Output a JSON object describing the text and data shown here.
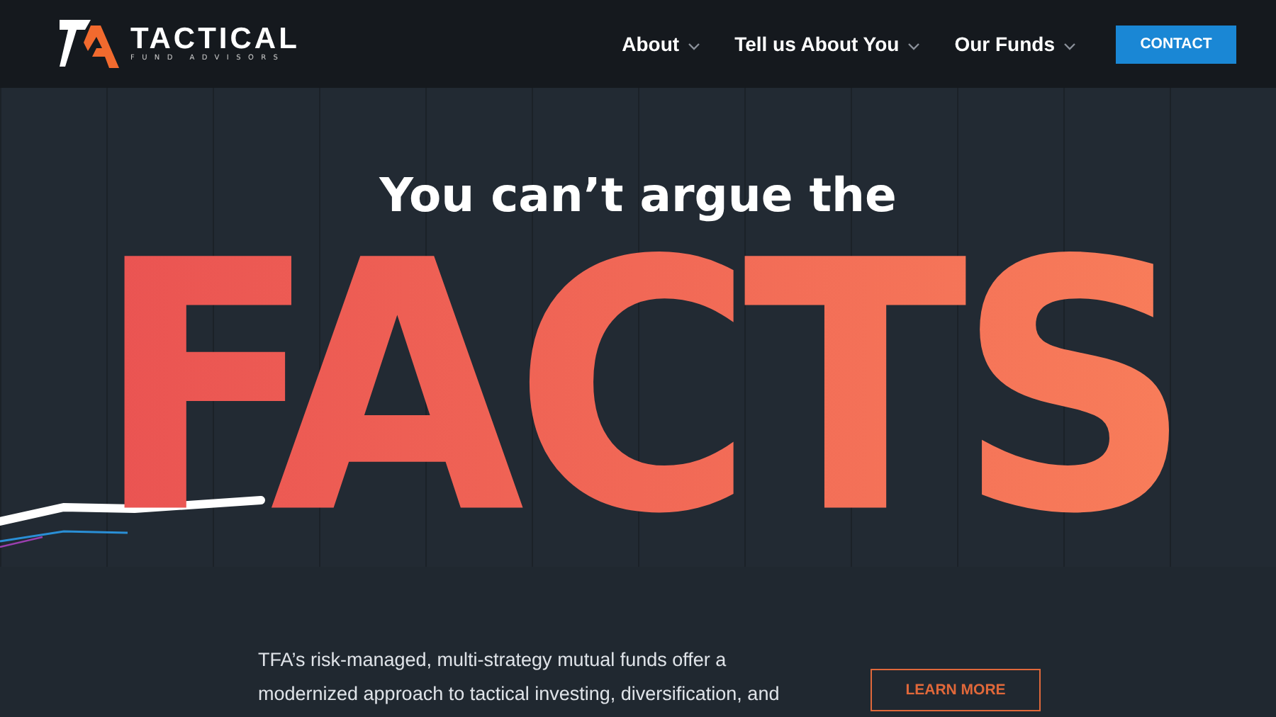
{
  "logo": {
    "name": "TACTICAL",
    "tagline": "FUND ADVISORS"
  },
  "nav": [
    {
      "label": "About",
      "has_menu": true
    },
    {
      "label": "Tell us About You",
      "has_menu": true
    },
    {
      "label": "Our Funds",
      "has_menu": true
    }
  ],
  "contact_button": "CONTACT",
  "hero": {
    "subtitle": "You can’t argue the",
    "headline": "FACTS"
  },
  "intro": {
    "text": "TFA’s risk-managed, multi-strategy mutual funds offer a modernized approach to tactical investing, diversification, and",
    "button": "LEARN MORE"
  }
}
